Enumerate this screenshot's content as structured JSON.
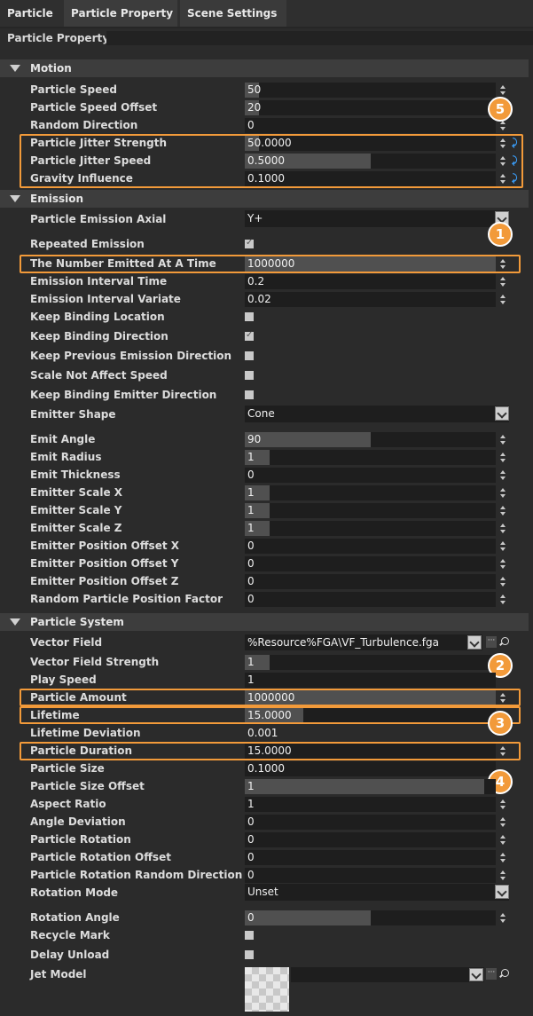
{
  "tabs": [
    "Particle",
    "Particle Property",
    "Scene Settings"
  ],
  "panel_title": "Particle Property",
  "sections": {
    "motion": "Motion",
    "emission": "Emission",
    "particle_system": "Particle System"
  },
  "motion": {
    "particle_speed": {
      "label": "Particle Speed",
      "value": "50"
    },
    "particle_speed_offset": {
      "label": "Particle Speed Offset",
      "value": "20"
    },
    "random_direction": {
      "label": "Random Direction",
      "value": "0"
    },
    "particle_jitter_strength": {
      "label": "Particle Jitter Strength",
      "value": "50.0000"
    },
    "particle_jitter_speed": {
      "label": "Particle Jitter Speed",
      "value": "0.5000"
    },
    "gravity_influence": {
      "label": "Gravity Influence",
      "value": "0.1000"
    }
  },
  "emission": {
    "particle_emission_axial": {
      "label": "Particle Emission Axial",
      "value": "Y+"
    },
    "repeated_emission": {
      "label": "Repeated Emission"
    },
    "number_emitted": {
      "label": "The Number Emitted At A Time",
      "value": "1000000"
    },
    "emission_interval_time": {
      "label": "Emission Interval Time",
      "value": "0.2"
    },
    "emission_interval_variate": {
      "label": "Emission Interval Variate",
      "value": "0.02"
    },
    "keep_binding_location": {
      "label": "Keep Binding Location"
    },
    "keep_binding_direction": {
      "label": "Keep Binding Direction"
    },
    "keep_previous_emission_direction": {
      "label": "Keep Previous Emission Direction"
    },
    "scale_not_affect_speed": {
      "label": "Scale Not Affect Speed"
    },
    "keep_binding_emitter_direction": {
      "label": "Keep Binding Emitter Direction"
    },
    "emitter_shape": {
      "label": "Emitter Shape",
      "value": "Cone"
    },
    "emit_angle": {
      "label": "Emit Angle",
      "value": "90"
    },
    "emit_radius": {
      "label": "Emit Radius",
      "value": "1"
    },
    "emit_thickness": {
      "label": "Emit Thickness",
      "value": "0"
    },
    "emitter_scale_x": {
      "label": "Emitter Scale X",
      "value": "1"
    },
    "emitter_scale_y": {
      "label": "Emitter Scale Y",
      "value": "1"
    },
    "emitter_scale_z": {
      "label": "Emitter Scale Z",
      "value": "1"
    },
    "emitter_position_offset_x": {
      "label": "Emitter Position Offset X",
      "value": "0"
    },
    "emitter_position_offset_y": {
      "label": "Emitter Position Offset Y",
      "value": "0"
    },
    "emitter_position_offset_z": {
      "label": "Emitter Position Offset Z",
      "value": "0"
    },
    "random_particle_position_factor": {
      "label": "Random Particle Position Factor",
      "value": "0"
    }
  },
  "particle_system": {
    "vector_field": {
      "label": "Vector Field",
      "value": "%Resource%FGA\\VF_Turbulence.fga"
    },
    "vector_field_strength": {
      "label": "Vector Field Strength",
      "value": "1"
    },
    "play_speed": {
      "label": "Play Speed",
      "value": "1"
    },
    "particle_amount": {
      "label": "Particle Amount",
      "value": "1000000"
    },
    "lifetime": {
      "label": "Lifetime",
      "value": "15.0000"
    },
    "lifetime_deviation": {
      "label": "Lifetime Deviation",
      "value": "0.001"
    },
    "particle_duration": {
      "label": "Particle Duration",
      "value": "15.0000"
    },
    "particle_size": {
      "label": "Particle Size",
      "value": "0.1000"
    },
    "particle_size_offset": {
      "label": "Particle Size Offset",
      "value": "1"
    },
    "aspect_ratio": {
      "label": "Aspect Ratio",
      "value": "1"
    },
    "angle_deviation": {
      "label": "Angle Deviation",
      "value": "0"
    },
    "particle_rotation": {
      "label": "Particle Rotation",
      "value": "0"
    },
    "particle_rotation_offset": {
      "label": "Particle Rotation Offset",
      "value": "0"
    },
    "particle_rotation_random_direction": {
      "label": "Particle Rotation Random Direction",
      "value": "0"
    },
    "rotation_mode": {
      "label": "Rotation Mode",
      "value": "Unset"
    },
    "rotation_angle": {
      "label": "Rotation Angle",
      "value": "0"
    },
    "recycle_mark": {
      "label": "Recycle Mark"
    },
    "delay_unload": {
      "label": "Delay Unload"
    },
    "jet_model": {
      "label": "Jet Model"
    }
  },
  "callouts": [
    "1",
    "2",
    "3",
    "4",
    "5"
  ],
  "colors": {
    "highlight": "#f29a3a",
    "reset_icon": "#3aa0ff"
  },
  "icons": {
    "reset": "reset-arrow-icon",
    "browse": "browse-dots-icon",
    "search": "search-icon"
  }
}
